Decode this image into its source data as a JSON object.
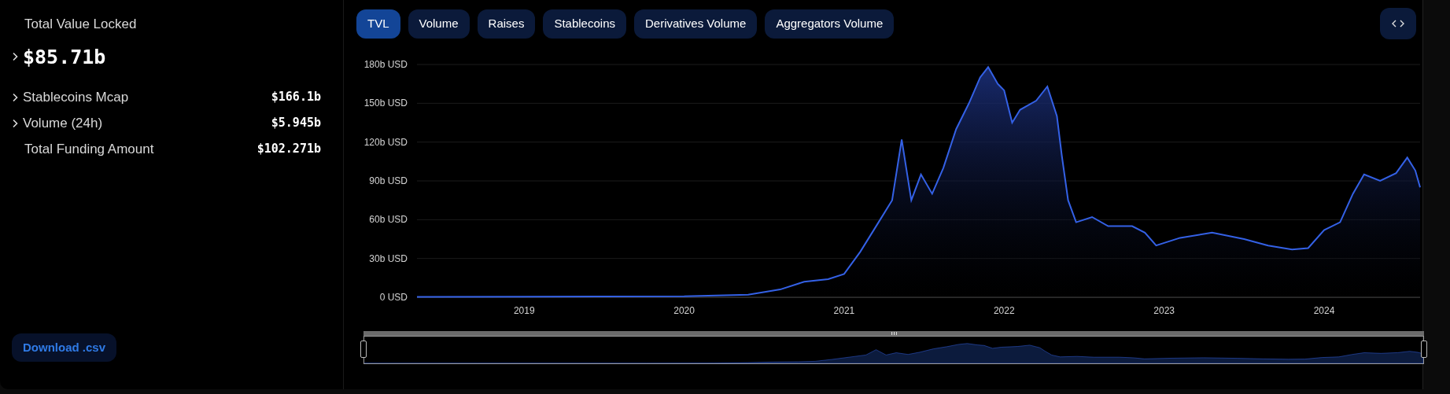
{
  "summary": {
    "label": "Total Value Locked",
    "value": "$85.71b",
    "expandable": true
  },
  "metrics": [
    {
      "label": "Stablecoins Mcap",
      "value": "$166.1b",
      "expandable": true
    },
    {
      "label": "Volume (24h)",
      "value": "$5.945b",
      "expandable": true
    },
    {
      "label": "Total Funding Amount",
      "value": "$102.271b",
      "expandable": false
    }
  ],
  "download_button": "Download .csv",
  "tabs": [
    {
      "label": "TVL",
      "selected": true
    },
    {
      "label": "Volume",
      "selected": false
    },
    {
      "label": "Raises",
      "selected": false
    },
    {
      "label": "Stablecoins",
      "selected": false
    },
    {
      "label": "Derivatives Volume",
      "selected": false
    },
    {
      "label": "Aggregators Volume",
      "selected": false
    }
  ],
  "chart": {
    "chart_data": {
      "type": "area",
      "grid": true,
      "xlim": [
        2018.33,
        2024.6
      ],
      "ylim": [
        0,
        180
      ],
      "xticks": [
        {
          "value": 2019,
          "label": "2019"
        },
        {
          "value": 2020,
          "label": "2020"
        },
        {
          "value": 2021,
          "label": "2021"
        },
        {
          "value": 2022,
          "label": "2022"
        },
        {
          "value": 2023,
          "label": "2023"
        },
        {
          "value": 2024,
          "label": "2024"
        }
      ],
      "yticks": [
        {
          "value": 0,
          "label": "0 USD"
        },
        {
          "value": 30,
          "label": "30b USD"
        },
        {
          "value": 60,
          "label": "60b USD"
        },
        {
          "value": 90,
          "label": "90b USD"
        },
        {
          "value": 120,
          "label": "120b USD"
        },
        {
          "value": 150,
          "label": "150b USD"
        },
        {
          "value": 180,
          "label": "180b USD"
        }
      ],
      "x": [
        2018.33,
        2019,
        2020,
        2020.4,
        2020.6,
        2020.75,
        2020.9,
        2021,
        2021.1,
        2021.2,
        2021.3,
        2021.36,
        2021.42,
        2021.48,
        2021.55,
        2021.62,
        2021.7,
        2021.78,
        2021.85,
        2021.9,
        2021.96,
        2022,
        2022.05,
        2022.1,
        2022.2,
        2022.27,
        2022.33,
        2022.36,
        2022.4,
        2022.45,
        2022.55,
        2022.65,
        2022.8,
        2022.88,
        2022.95,
        2023.1,
        2023.3,
        2023.5,
        2023.65,
        2023.8,
        2023.9,
        2024,
        2024.1,
        2024.18,
        2024.25,
        2024.35,
        2024.45,
        2024.52,
        2024.57,
        2024.6
      ],
      "series": [
        {
          "color": "#3461e6",
          "values": [
            0.3,
            0.5,
            0.8,
            2,
            6,
            12,
            14,
            18,
            35,
            55,
            75,
            122,
            75,
            95,
            80,
            100,
            130,
            150,
            170,
            178,
            165,
            160,
            135,
            145,
            152,
            163,
            140,
            110,
            75,
            58,
            62,
            55,
            55,
            50,
            40,
            46,
            50,
            45,
            40,
            37,
            38,
            52,
            58,
            80,
            95,
            90,
            96,
            108,
            98,
            85
          ]
        }
      ]
    }
  }
}
